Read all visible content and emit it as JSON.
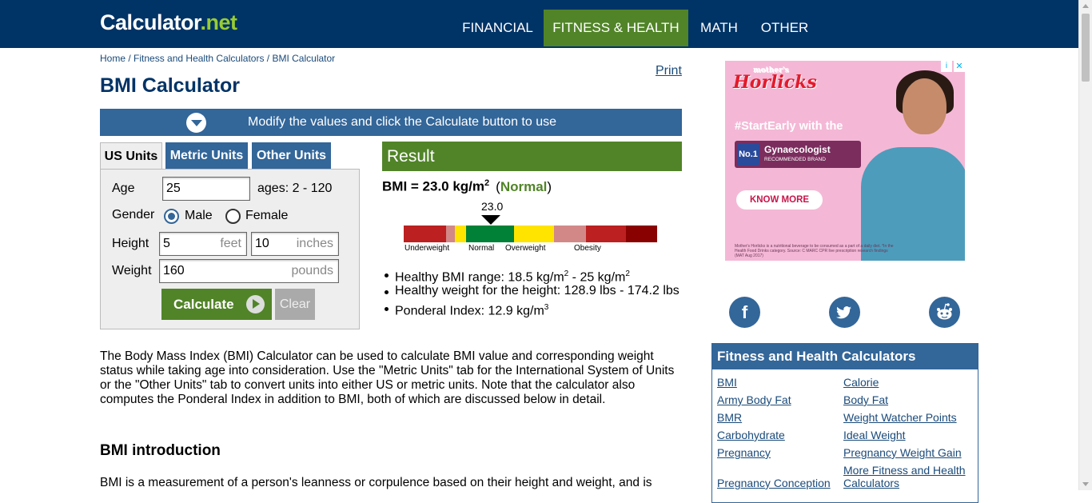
{
  "header": {
    "logo_main": "Calculator",
    "logo_ext": ".net",
    "nav": [
      "FINANCIAL",
      "FITNESS & HEALTH",
      "MATH",
      "OTHER"
    ]
  },
  "breadcrumb": [
    "Home",
    "Fitness and Health Calculators",
    "BMI Calculator"
  ],
  "breadcrumb_sep": " / ",
  "print_label": "Print",
  "page_title": "BMI Calculator",
  "banner_text": "Modify the values and click the Calculate button to use",
  "tabs": [
    "US Units",
    "Metric Units",
    "Other Units"
  ],
  "form": {
    "age_label": "Age",
    "age_value": "25",
    "age_hint": "ages: 2 - 120",
    "gender_label": "Gender",
    "gender_options": [
      "Male",
      "Female"
    ],
    "gender_selected": "Male",
    "height_label": "Height",
    "height_feet": "5",
    "height_feet_unit": "feet",
    "height_inches": "10",
    "height_inches_unit": "inches",
    "weight_label": "Weight",
    "weight_value": "160",
    "weight_unit": "pounds",
    "calculate_label": "Calculate",
    "clear_label": "Clear"
  },
  "result": {
    "heading": "Result",
    "bmi_text": "BMI = 23.0 kg/m",
    "bmi_sup": "2",
    "status_open": "(",
    "status": "Normal",
    "status_close": ")",
    "gauge_value": "23.0",
    "gauge_labels": [
      "Underweight",
      "Normal",
      "Overweight",
      "Obesity"
    ],
    "gauge_colors": [
      "#bc2020",
      "#d38888",
      "#ffe400",
      "#008137",
      "#ffe400",
      "#d38888",
      "#bc2020",
      "#8a0101"
    ],
    "lines": {
      "healthy_range_a": "Healthy BMI range: 18.5 kg/m",
      "sup_a": "2",
      "healthy_range_b": " - 25 kg/m",
      "sup_b": "2",
      "healthy_weight": "Healthy weight for the height: 128.9 lbs - 174.2 lbs",
      "ponderal": "Ponderal Index: 12.9 kg/m",
      "sup_c": "3"
    }
  },
  "description": "The Body Mass Index (BMI) Calculator can be used to calculate BMI value and corresponding weight status while taking age into consideration. Use the \"Metric Units\" tab for the International System of Units or the \"Other Units\" tab to convert units into either US or metric units. Note that the calculator also computes the Ponderal Index in addition to BMI, both of which are discussed below in detail.",
  "section_heading": "BMI introduction",
  "section_text": "BMI is a measurement of a person's leanness or corpulence based on their height and weight, and is",
  "ad": {
    "brand_small": "mother's",
    "brand": "Horlicks",
    "headline": "#StartEarly with the",
    "badge_no": "No.1",
    "badge_title": "Gynaecologist",
    "badge_sub": "RECOMMENDED BRAND",
    "cta": "KNOW MORE",
    "fine_print": "Mother's Horlicks is a nutritional beverage to be consumed as a part of a daily diet. *In the Health Food Drinks category. Source: C MARC CPR live prescription research findings (MAT Aug 2017)"
  },
  "social": [
    "facebook-icon",
    "twitter-icon",
    "reddit-icon"
  ],
  "sidebar": {
    "heading": "Fitness and Health Calculators",
    "left_links": [
      "BMI",
      "Army Body Fat",
      "BMR",
      "Carbohydrate",
      "Pregnancy",
      "Pregnancy Conception"
    ],
    "right_links": [
      "Calorie",
      "Body Fat",
      "Weight Watcher Points",
      "Ideal Weight",
      "Pregnancy Weight Gain",
      "More Fitness and Health Calculators"
    ]
  }
}
